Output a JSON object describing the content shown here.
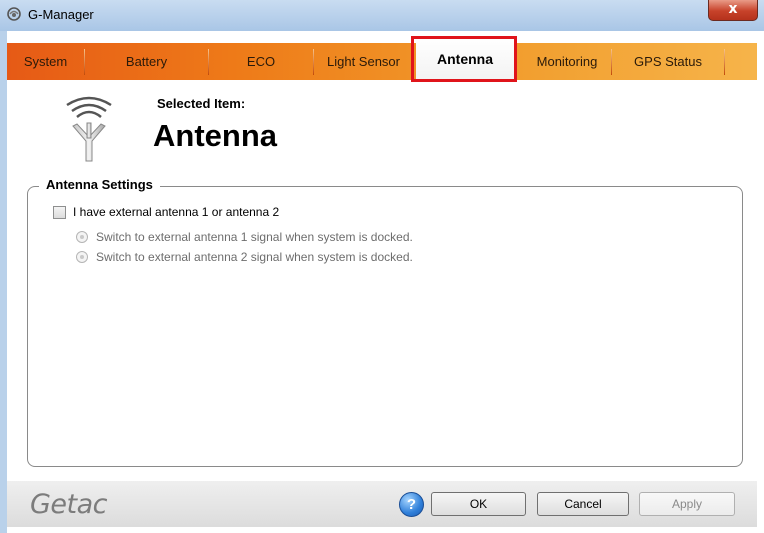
{
  "window": {
    "title": "G-Manager",
    "close_label": "x"
  },
  "tabs": [
    {
      "label": "System"
    },
    {
      "label": "Battery"
    },
    {
      "label": "ECO"
    },
    {
      "label": "Light Sensor"
    },
    {
      "label": "Antenna",
      "active": true
    },
    {
      "label": "Monitoring"
    },
    {
      "label": "GPS Status"
    }
  ],
  "header": {
    "selected_label": "Selected Item:",
    "selected_value": "Antenna"
  },
  "antenna_settings": {
    "group_title": "Antenna Settings",
    "checkbox_label": "I have external antenna 1 or antenna 2",
    "checkbox_checked": false,
    "radio_options": [
      {
        "label": "Switch to external antenna 1 signal when system is docked.",
        "enabled": false
      },
      {
        "label": "Switch to external antenna 2 signal when system is docked.",
        "enabled": false
      }
    ]
  },
  "footer": {
    "logo": "Getac",
    "help_label": "?",
    "ok_label": "OK",
    "cancel_label": "Cancel",
    "apply_label": "Apply"
  },
  "colors": {
    "tab_gradient_start": "#e65a16",
    "tab_gradient_end": "#f6b44a",
    "highlight": "#e0141b"
  },
  "icons": {
    "app": "getac-app-icon",
    "header": "antenna-icon",
    "help": "help-icon"
  }
}
